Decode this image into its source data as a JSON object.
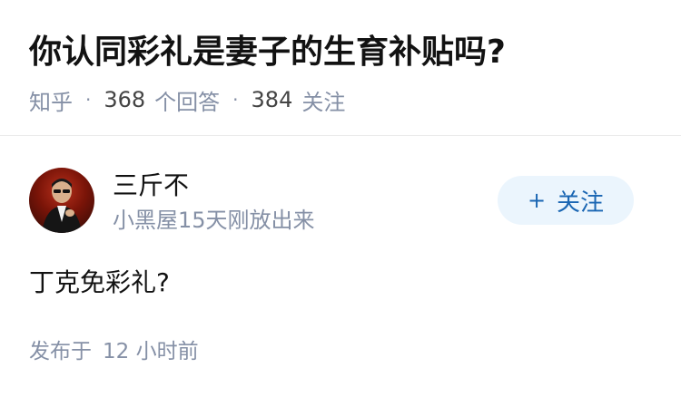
{
  "question": {
    "title": "你认同彩礼是妻子的生育补贴吗?",
    "meta": {
      "source": "知乎",
      "separator": "·",
      "answer_count": "368",
      "answer_label": "个回答",
      "follower_count": "384",
      "follower_label": "关注"
    }
  },
  "answer": {
    "author": {
      "name": "三斤不",
      "bio": "小黑屋15天刚放出来",
      "avatar_icon": "avatar-portrait-icon"
    },
    "follow_button": {
      "icon": "+",
      "label": "关注"
    },
    "content": "丁克免彩礼?",
    "published": {
      "label": "发布于",
      "time": "12 小时前"
    }
  },
  "colors": {
    "title_text": "#121212",
    "meta_text": "#8590a6",
    "follow_bg": "#ebf5fd",
    "follow_text": "#1a66b3",
    "divider": "#ebebeb"
  }
}
